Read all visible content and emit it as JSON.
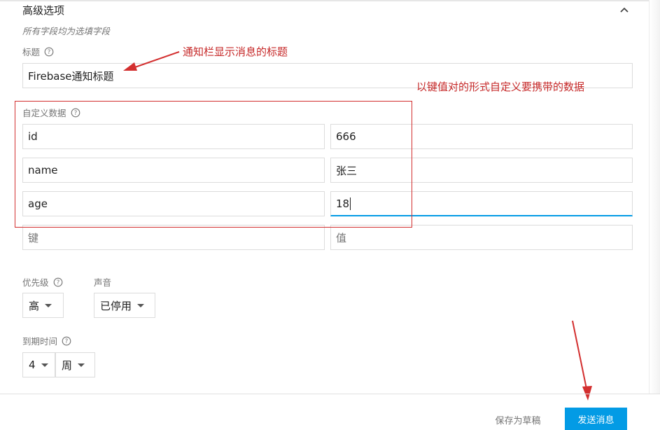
{
  "section": {
    "title": "高级选项",
    "subtitle": "所有字段均为选填字段"
  },
  "title_field": {
    "label": "标题",
    "value": "Firebase通知标题"
  },
  "custom_data": {
    "label": "自定义数据",
    "rows": [
      {
        "key": "id",
        "value": "666"
      },
      {
        "key": "name",
        "value": "张三"
      },
      {
        "key": "age",
        "value": "18"
      }
    ],
    "key_placeholder": "键",
    "value_placeholder": "值"
  },
  "priority": {
    "label": "优先级",
    "value": "高"
  },
  "sound": {
    "label": "声音",
    "value": "已停用"
  },
  "expiry": {
    "label": "到期时间",
    "amount": "4",
    "unit": "周"
  },
  "annotations": {
    "title_note": "通知栏显示消息的标题",
    "data_note": "以键值对的形式自定义要携带的数据"
  },
  "footer": {
    "save_draft": "保存为草稿",
    "send": "发送消息"
  },
  "colors": {
    "accent": "#039be5",
    "annotation": "#d32f2f"
  }
}
